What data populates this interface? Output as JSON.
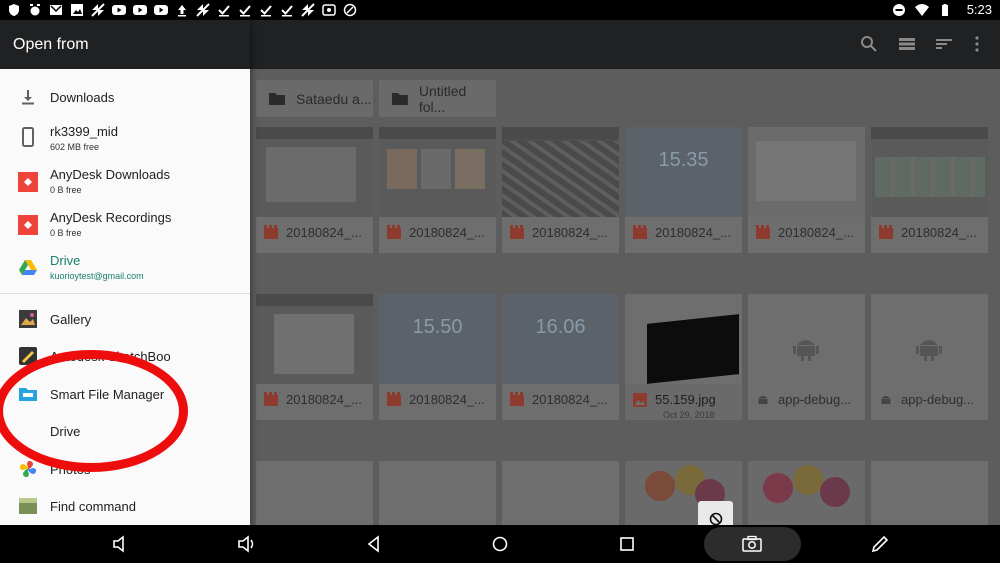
{
  "status": {
    "time": "5:23"
  },
  "drawer": {
    "title": "Open from",
    "items": [
      {
        "label": "Downloads",
        "sub": ""
      },
      {
        "label": "rk3399_mid",
        "sub": "602 MB free"
      },
      {
        "label": "AnyDesk Downloads",
        "sub": "0 B free"
      },
      {
        "label": "AnyDesk Recordings",
        "sub": "0 B free"
      },
      {
        "label": "Drive",
        "sub": "kuorioytest@gmail.com"
      },
      {
        "label": "Gallery",
        "sub": ""
      },
      {
        "label": "Autodesk SketchBook",
        "sub": ""
      },
      {
        "label": "Smart File Manager",
        "sub": ""
      },
      {
        "label": "Drive",
        "sub": ""
      },
      {
        "label": "Photos",
        "sub": ""
      },
      {
        "label": "Find command",
        "sub": ""
      }
    ]
  },
  "main": {
    "folders": [
      "Sataedu a...",
      "Untitled fol..."
    ],
    "files": [
      {
        "name": "20180824_...",
        "kind": "video",
        "overlay": ""
      },
      {
        "name": "20180824_...",
        "kind": "video",
        "overlay": ""
      },
      {
        "name": "20180824_...",
        "kind": "video",
        "overlay": ""
      },
      {
        "name": "20180824_...",
        "kind": "video",
        "overlay": "15.35"
      },
      {
        "name": "20180824_...",
        "kind": "video",
        "overlay": ""
      },
      {
        "name": "20180824_...",
        "kind": "video",
        "overlay": ""
      },
      {
        "name": "20180824_...",
        "kind": "video",
        "overlay": ""
      },
      {
        "name": "20180824_...",
        "kind": "video",
        "overlay": "15.50"
      },
      {
        "name": "20180824_...",
        "kind": "video",
        "overlay": "16.06"
      },
      {
        "name": "55.159.jpg",
        "kind": "image",
        "overlay": "",
        "sub": "Oct 29, 2018"
      },
      {
        "name": "app-debug...",
        "kind": "apk",
        "overlay": ""
      },
      {
        "name": "app-debug...",
        "kind": "apk",
        "overlay": ""
      }
    ]
  },
  "colors": {
    "accent": "#19806e",
    "annotation": "#ee0d0d",
    "toolbar": "#1f2123"
  }
}
